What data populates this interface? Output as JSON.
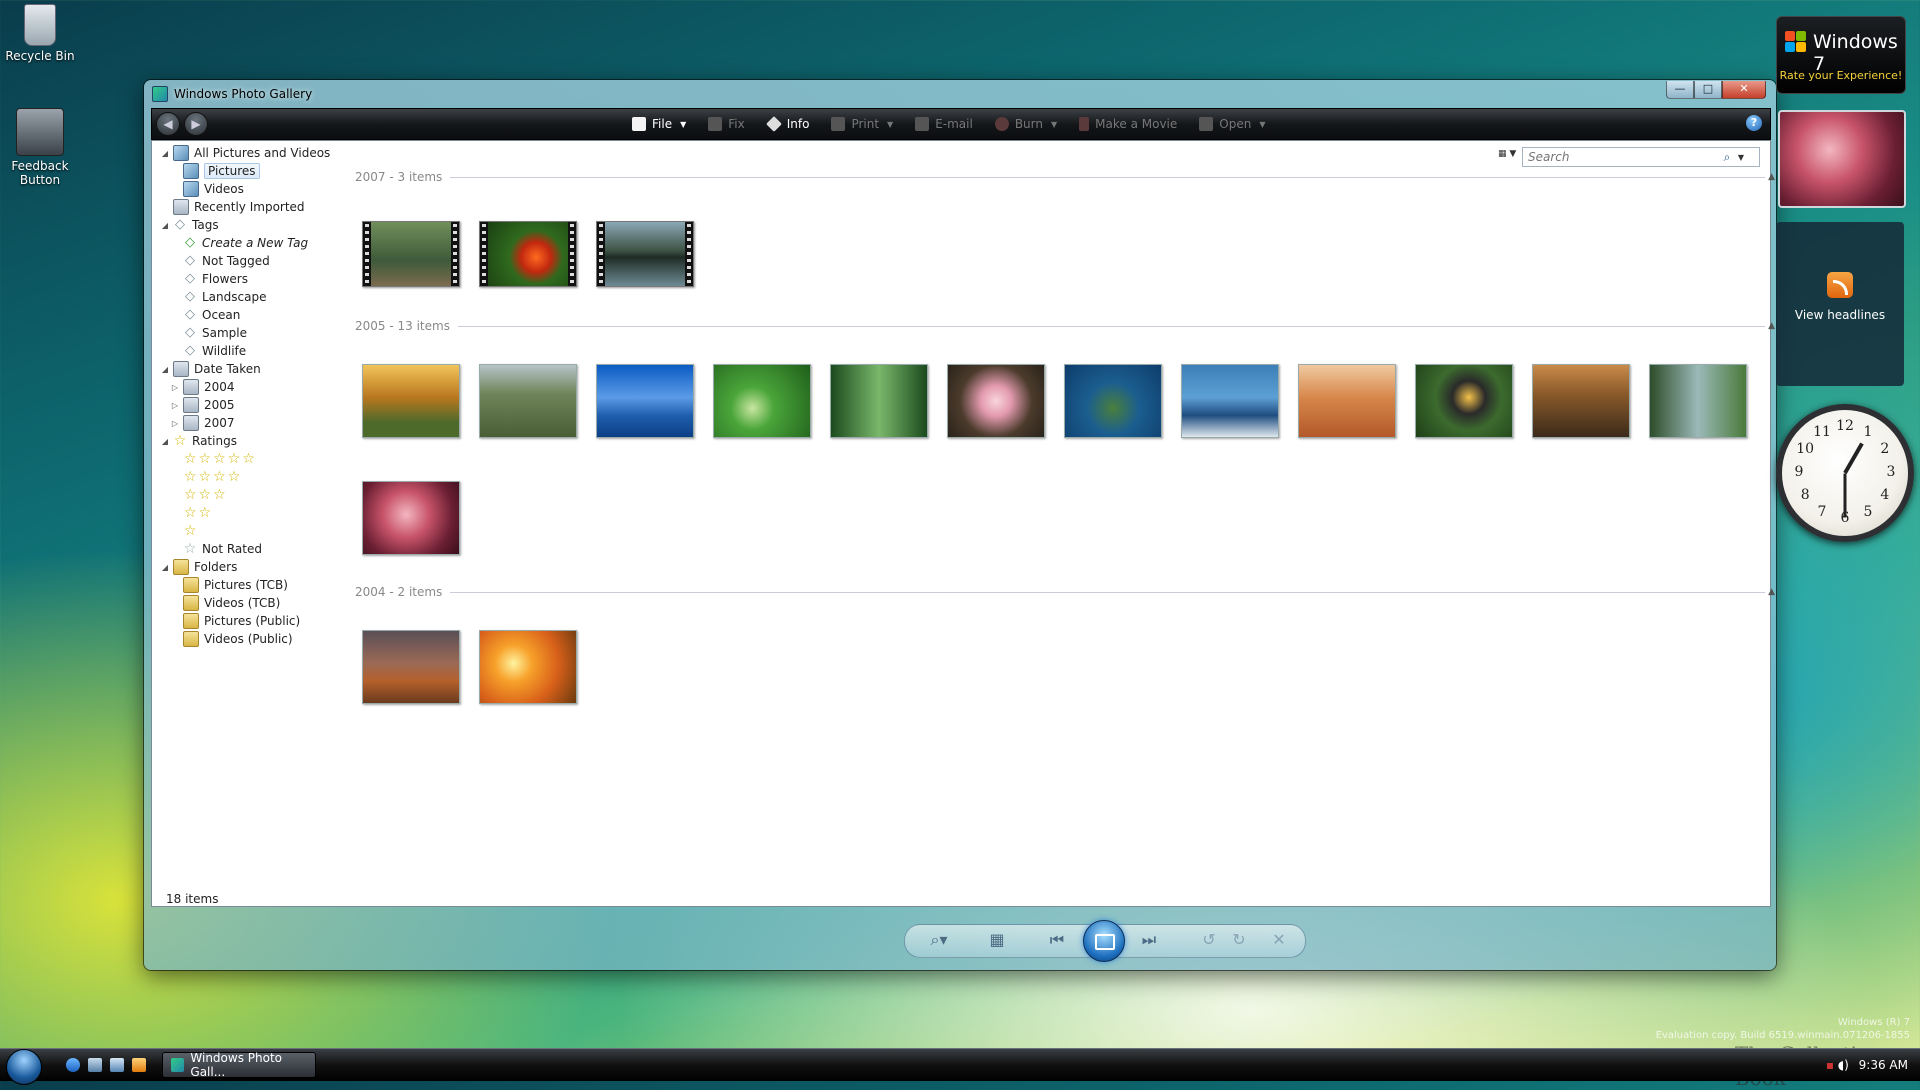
{
  "desktop": {
    "recycle_bin": "Recycle Bin",
    "feedback_button": "Feedback Button"
  },
  "window": {
    "title": "Windows Photo Gallery",
    "min": "—",
    "max": "□",
    "close": "✕"
  },
  "toolbar": {
    "back": "◀",
    "forward": "▶",
    "file": "File",
    "fix": "Fix",
    "info": "Info",
    "print": "Print",
    "email": "E-mail",
    "burn": "Burn",
    "make_movie": "Make a Movie",
    "open": "Open",
    "help": "?"
  },
  "nav": {
    "all": "All Pictures and Videos",
    "pictures": "Pictures",
    "videos": "Videos",
    "recent": "Recently Imported",
    "tags": "Tags",
    "create_tag": "Create a New Tag",
    "not_tagged": "Not Tagged",
    "flowers": "Flowers",
    "landscape": "Landscape",
    "ocean": "Ocean",
    "sample": "Sample",
    "wildlife": "Wildlife",
    "date_taken": "Date Taken",
    "y2004": "2004",
    "y2005": "2005",
    "y2007": "2007",
    "ratings": "Ratings",
    "stars5": "☆☆☆☆☆",
    "stars4": "☆☆☆☆",
    "stars3": "☆☆☆",
    "stars2": "☆☆",
    "stars1": "☆",
    "not_rated": "Not Rated",
    "folders": "Folders",
    "pictures_tcb": "Pictures (TCB)",
    "videos_tcb": "Videos (TCB)",
    "pictures_public": "Pictures (Public)",
    "videos_public": "Videos (Public)"
  },
  "search": {
    "placeholder": "Search"
  },
  "groups": {
    "g2007": "2007 - 3 items",
    "g2005": "2005 - 13 items",
    "g2004": "2004 - 2 items"
  },
  "status": {
    "count": "18 items"
  },
  "gadgets": {
    "win7_title": "Windows 7",
    "win7_sub": "Rate your Experience!",
    "feed_label": "View headlines",
    "clock_numbers": [
      "12",
      "1",
      "2",
      "3",
      "4",
      "5",
      "6",
      "7",
      "8",
      "9",
      "10",
      "11"
    ]
  },
  "taskbar": {
    "button": "Windows Photo Gall...",
    "time": "9:36 AM"
  },
  "watermark": {
    "line1": "Windows (R) 7",
    "line2": "Evaluation copy. Build 6519.winmain.071206-1855",
    "brand": "The Collection Book"
  }
}
